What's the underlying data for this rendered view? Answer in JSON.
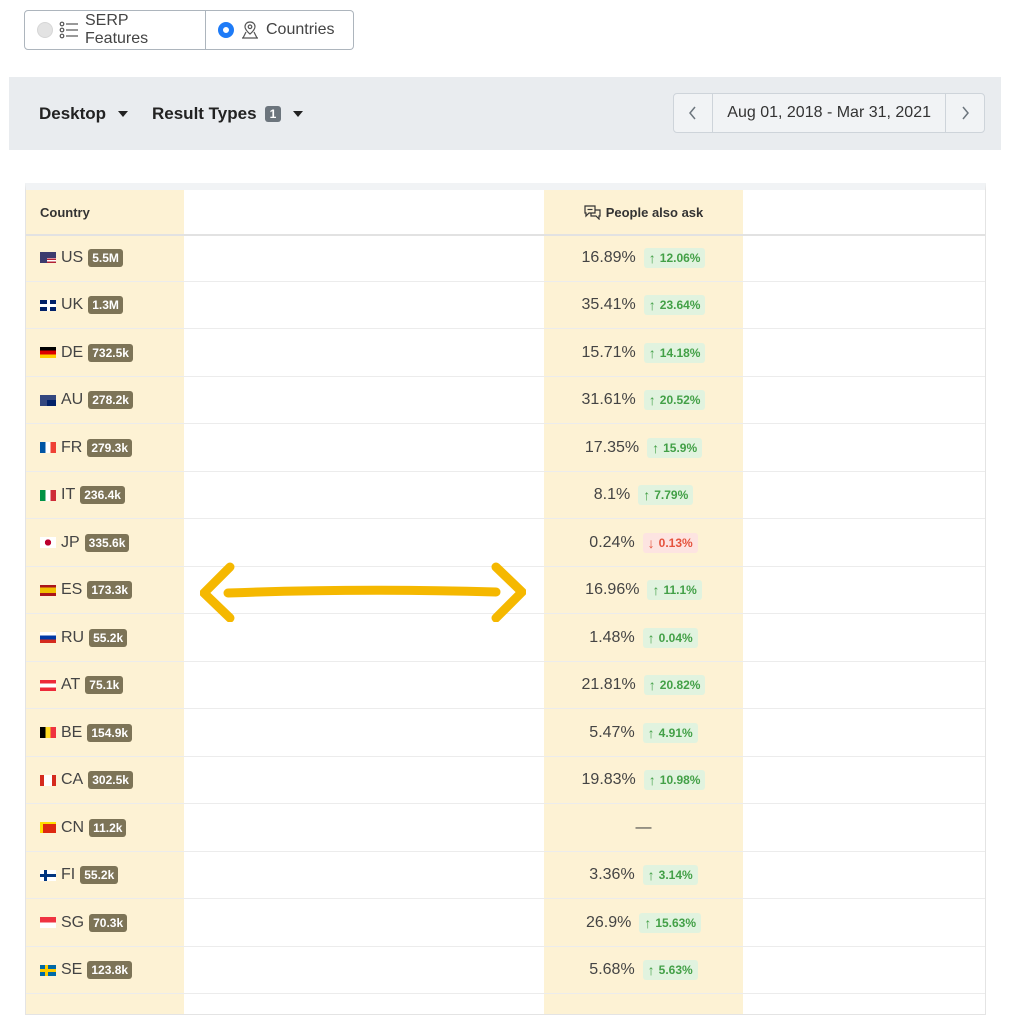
{
  "toggle": {
    "serp_label": "SERP Features",
    "countries_label": "Countries",
    "selected": "Countries"
  },
  "toolbar": {
    "device_label": "Desktop",
    "result_types_label": "Result Types",
    "result_types_count": "1",
    "date_range": "Aug 01, 2018 - Mar 31, 2021",
    "prev_icon": "chevron-left-icon",
    "next_icon": "chevron-right-icon"
  },
  "table": {
    "headers": {
      "country": "Country",
      "paa": "People also ask"
    },
    "rows": [
      {
        "code": "US",
        "volume": "5.5M",
        "paa": "16.89%",
        "change": "12.06%",
        "dir": "up"
      },
      {
        "code": "UK",
        "volume": "1.3M",
        "paa": "35.41%",
        "change": "23.64%",
        "dir": "up"
      },
      {
        "code": "DE",
        "volume": "732.5k",
        "paa": "15.71%",
        "change": "14.18%",
        "dir": "up"
      },
      {
        "code": "AU",
        "volume": "278.2k",
        "paa": "31.61%",
        "change": "20.52%",
        "dir": "up"
      },
      {
        "code": "FR",
        "volume": "279.3k",
        "paa": "17.35%",
        "change": "15.9%",
        "dir": "up"
      },
      {
        "code": "IT",
        "volume": "236.4k",
        "paa": "8.1%",
        "change": "7.79%",
        "dir": "up"
      },
      {
        "code": "JP",
        "volume": "335.6k",
        "paa": "0.24%",
        "change": "0.13%",
        "dir": "down"
      },
      {
        "code": "ES",
        "volume": "173.3k",
        "paa": "16.96%",
        "change": "11.1%",
        "dir": "up"
      },
      {
        "code": "RU",
        "volume": "55.2k",
        "paa": "1.48%",
        "change": "0.04%",
        "dir": "up"
      },
      {
        "code": "AT",
        "volume": "75.1k",
        "paa": "21.81%",
        "change": "20.82%",
        "dir": "up"
      },
      {
        "code": "BE",
        "volume": "154.9k",
        "paa": "5.47%",
        "change": "4.91%",
        "dir": "up"
      },
      {
        "code": "CA",
        "volume": "302.5k",
        "paa": "19.83%",
        "change": "10.98%",
        "dir": "up"
      },
      {
        "code": "CN",
        "volume": "11.2k",
        "paa": "—",
        "change": "",
        "dir": "none"
      },
      {
        "code": "FI",
        "volume": "55.2k",
        "paa": "3.36%",
        "change": "3.14%",
        "dir": "up"
      },
      {
        "code": "SG",
        "volume": "70.3k",
        "paa": "26.9%",
        "change": "15.63%",
        "dir": "up"
      },
      {
        "code": "SE",
        "volume": "123.8k",
        "paa": "5.68%",
        "change": "5.63%",
        "dir": "up"
      }
    ]
  },
  "colors": {
    "highlight": "#fdf2d4",
    "arrow": "#f5b800",
    "positive": "#43a047",
    "negative": "#e5533d",
    "volume_badge": "#7d7457"
  }
}
